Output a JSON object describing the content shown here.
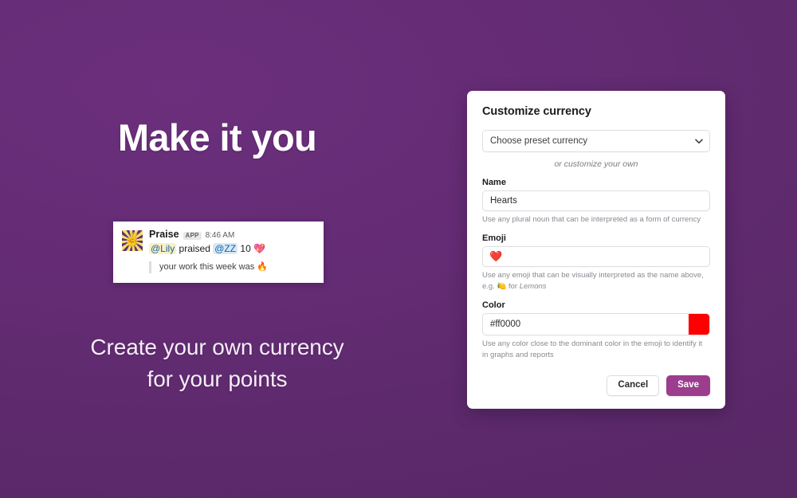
{
  "hero": {
    "headline": "Make it you",
    "subline_line1": "Create your own currency",
    "subline_line2": "for your points"
  },
  "slack_message": {
    "avatar_icon": "praise-hand-starburst-icon",
    "avatar_glyph": "✌",
    "sender": "Praise",
    "app_badge": "APP",
    "time": "8:46 AM",
    "mention_from": "@Lily",
    "verb": "praised",
    "mention_to": "@ZZ",
    "amount": "10",
    "currency_emoji": "💖",
    "quote": "your work this week was",
    "quote_emoji": "🔥"
  },
  "panel": {
    "title": "Customize currency",
    "preset_select": {
      "value": "Choose preset currency",
      "chevron_icon": "chevron-down-icon"
    },
    "or_text": "or customize your own",
    "name_field": {
      "label": "Name",
      "value": "Hearts",
      "placeholder": "Hearts",
      "help": "Use any plural noun that can be interpreted as a form of currency"
    },
    "emoji_field": {
      "label": "Emoji",
      "value": "❤️",
      "help_prefix": "Use any emoji that can be visually interpreted as the name above, e.g.",
      "help_emoji": "🍋",
      "help_suffix": "for",
      "help_italic": "Lemons"
    },
    "color_field": {
      "label": "Color",
      "value": "#ff0000",
      "placeholder": "#ff0000",
      "swatch_color": "#ff0000",
      "help": "Use any color close to the dominant color in the emoji to identify it in graphs and reports"
    },
    "cancel_label": "Cancel",
    "save_label": "Save"
  },
  "theme": {
    "background_top_left": "#612a72",
    "background_bottom_right": "#782f84",
    "primary_button": "#9c3d8d",
    "swatch_red": "#ff0000"
  }
}
